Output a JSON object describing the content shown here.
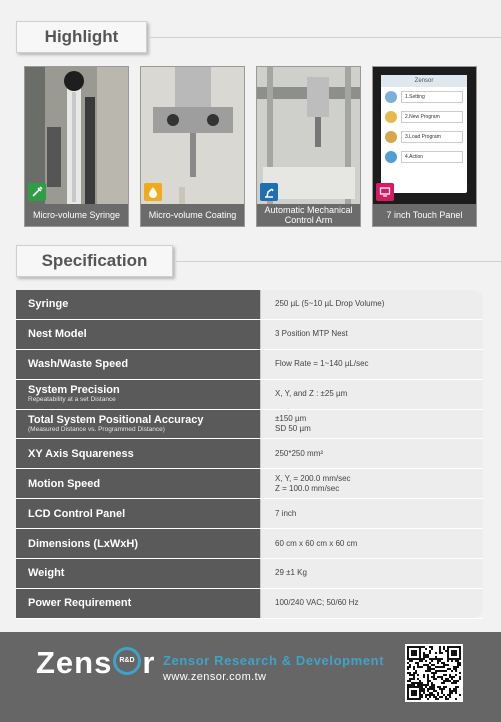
{
  "sections": {
    "highlight_title": "Highlight",
    "specification_title": "Specification"
  },
  "highlights": [
    {
      "caption": "Micro-volume Syringe",
      "badge_color": "#2e9e44",
      "icon": "syringe-icon"
    },
    {
      "caption": "Micro-volume Coating",
      "badge_color": "#f2a91a",
      "icon": "drop-icon"
    },
    {
      "caption": "Automatic Mechanical Control Arm",
      "badge_color": "#1f6fb3",
      "icon": "robot-arm-icon"
    },
    {
      "caption": "7 inch Touch Panel",
      "badge_color": "#d81b60",
      "icon": "touch-panel-icon"
    }
  ],
  "touch_panel": {
    "title": "Zensor",
    "menu": [
      "1.Setting",
      "2.New Program",
      "3.Load Program",
      "4.Action"
    ]
  },
  "specs": [
    {
      "key": "Syringe",
      "sub": "",
      "value": [
        "250 µL (5~10 µL Drop Volume)"
      ]
    },
    {
      "key": "Nest Model",
      "sub": "",
      "value": [
        "3 Position MTP Nest"
      ]
    },
    {
      "key": "Wash/Waste Speed",
      "sub": "",
      "value": [
        "Flow Rate = 1~140 µL/sec"
      ]
    },
    {
      "key": "System Precision",
      "sub": "Repeatability at a set Distance",
      "value": [
        "X, Y, and Z : ±25 µm"
      ]
    },
    {
      "key": "Total System Positional Accuracy",
      "sub": "(Measured Distance vs. Programmed Distance)",
      "value": [
        "±150 µm",
        "SD 50 µm"
      ]
    },
    {
      "key": "XY Axis Squareness",
      "sub": "",
      "value": [
        "250*250 mm²"
      ]
    },
    {
      "key": "Motion Speed",
      "sub": "",
      "value": [
        "X, Y, = 200.0  mm/sec",
        "Z = 100.0  mm/sec"
      ]
    },
    {
      "key": "LCD Control Panel",
      "sub": "",
      "value": [
        "7 inch"
      ]
    },
    {
      "key": "Dimensions (LxWxH)",
      "sub": "",
      "value": [
        "60 cm x 60 cm x 60 cm"
      ]
    },
    {
      "key": "Weight",
      "sub": "",
      "value": [
        "29 ±1 Kg"
      ]
    },
    {
      "key": "Power Requirement",
      "sub": "",
      "value": [
        "100/240 VAC; 50/60 Hz"
      ]
    }
  ],
  "footer": {
    "logo_left": "Zens",
    "logo_badge": "R&D",
    "logo_right": "r",
    "company": "Zensor Research & Development",
    "url": "www.zensor.com.tw",
    "accent": "#3fa3c8"
  }
}
